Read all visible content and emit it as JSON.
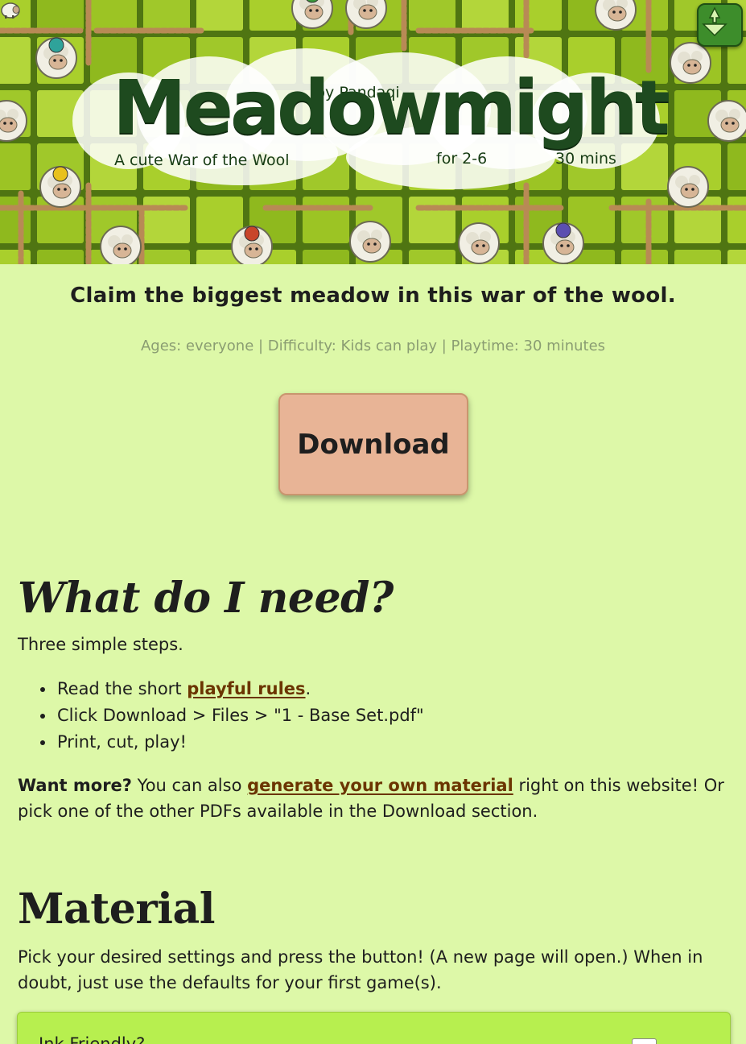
{
  "header": {
    "title": "Meadowmight",
    "author": "by Pandaqi",
    "subtitle": "A cute War of the Wool",
    "players": "for 2-6",
    "duration": "30 mins"
  },
  "intro": {
    "tagline": "Claim the biggest meadow in this war of the wool.",
    "meta": "Ages: everyone | Difficulty: Kids can play | Playtime: 30 minutes",
    "download_label": "Download"
  },
  "need_section": {
    "heading": "What do I need?",
    "intro": "Three simple steps.",
    "steps": [
      {
        "prefix": "Read the short ",
        "link": "playful rules",
        "suffix": "."
      },
      {
        "text": "Click Download > Files > \"1 - Base Set.pdf\""
      },
      {
        "text": "Print, cut, play!"
      }
    ],
    "more_bold": "Want more?",
    "more_pre": " You can also ",
    "more_link": "generate your own material",
    "more_post": " right on this website! Or pick one of the other PDFs available in the Download section."
  },
  "material_section": {
    "heading": "Material",
    "description": "Pick your desired settings and press the button! (A new page will open.) When in doubt, just use the defaults for your first game(s).",
    "settings": [
      {
        "label": "Ink Friendly?",
        "checked": false
      }
    ]
  },
  "colors": {
    "page_bg": "#ddf8a8",
    "download_bg": "#e8b496",
    "link": "#6b3500",
    "settings_bg": "#b7ef4f",
    "meta_text": "#8a9d72"
  }
}
